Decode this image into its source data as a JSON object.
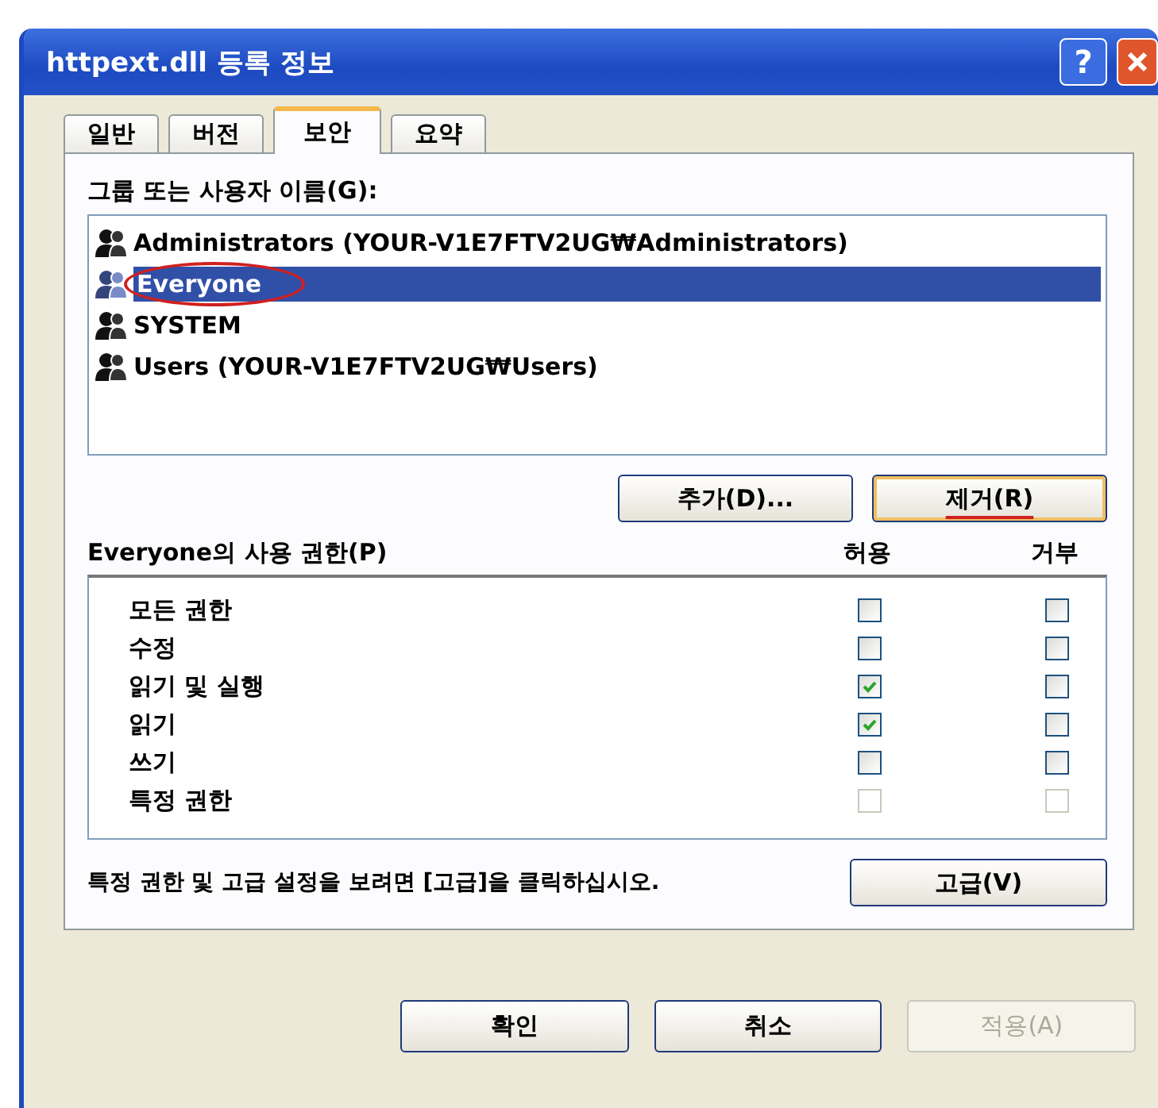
{
  "window": {
    "title": "httpext.dll 등록 정보",
    "help_button": "?"
  },
  "tabs": [
    {
      "label": "일반",
      "selected": false
    },
    {
      "label": "버전",
      "selected": false
    },
    {
      "label": "보안",
      "selected": true
    },
    {
      "label": "요약",
      "selected": false
    }
  ],
  "groups": {
    "label": "그룹 또는 사용자 이름(G):",
    "items": [
      {
        "name": "Administrators (YOUR-V1E7FTV2UG₩Administrators)",
        "selected": false,
        "circled": false
      },
      {
        "name": "Everyone",
        "selected": true,
        "circled": true
      },
      {
        "name": "SYSTEM",
        "selected": false,
        "circled": false
      },
      {
        "name": "Users (YOUR-V1E7FTV2UG₩Users)",
        "selected": false,
        "circled": false
      }
    ],
    "buttons": [
      {
        "label": "추가(D)...",
        "focused": false,
        "underlined": false
      },
      {
        "label": "제거(R)",
        "focused": true,
        "underlined": true
      }
    ]
  },
  "permissions": {
    "label": "Everyone의 사용 권한(P)",
    "allow_header": "허용",
    "deny_header": "거부",
    "rows": [
      {
        "name": "모든 권한",
        "allow": {
          "checked": false,
          "disabled": false
        },
        "deny": {
          "checked": false,
          "disabled": false
        }
      },
      {
        "name": "수정",
        "allow": {
          "checked": false,
          "disabled": false
        },
        "deny": {
          "checked": false,
          "disabled": false
        }
      },
      {
        "name": "읽기 및 실행",
        "allow": {
          "checked": true,
          "disabled": false
        },
        "deny": {
          "checked": false,
          "disabled": false
        }
      },
      {
        "name": "읽기",
        "allow": {
          "checked": true,
          "disabled": false
        },
        "deny": {
          "checked": false,
          "disabled": false
        }
      },
      {
        "name": "쓰기",
        "allow": {
          "checked": false,
          "disabled": false
        },
        "deny": {
          "checked": false,
          "disabled": false
        }
      },
      {
        "name": "특정 권한",
        "allow": {
          "checked": false,
          "disabled": true
        },
        "deny": {
          "checked": false,
          "disabled": true
        }
      }
    ]
  },
  "advanced": {
    "hint": "특정 권한 및 고급 설정을 보려면 [고급]을 클릭하십시오.",
    "button": "고급(V)"
  },
  "dialog_buttons": [
    {
      "label": "확인",
      "disabled": false
    },
    {
      "label": "취소",
      "disabled": false
    },
    {
      "label": "적용(A)",
      "disabled": true
    }
  ]
}
